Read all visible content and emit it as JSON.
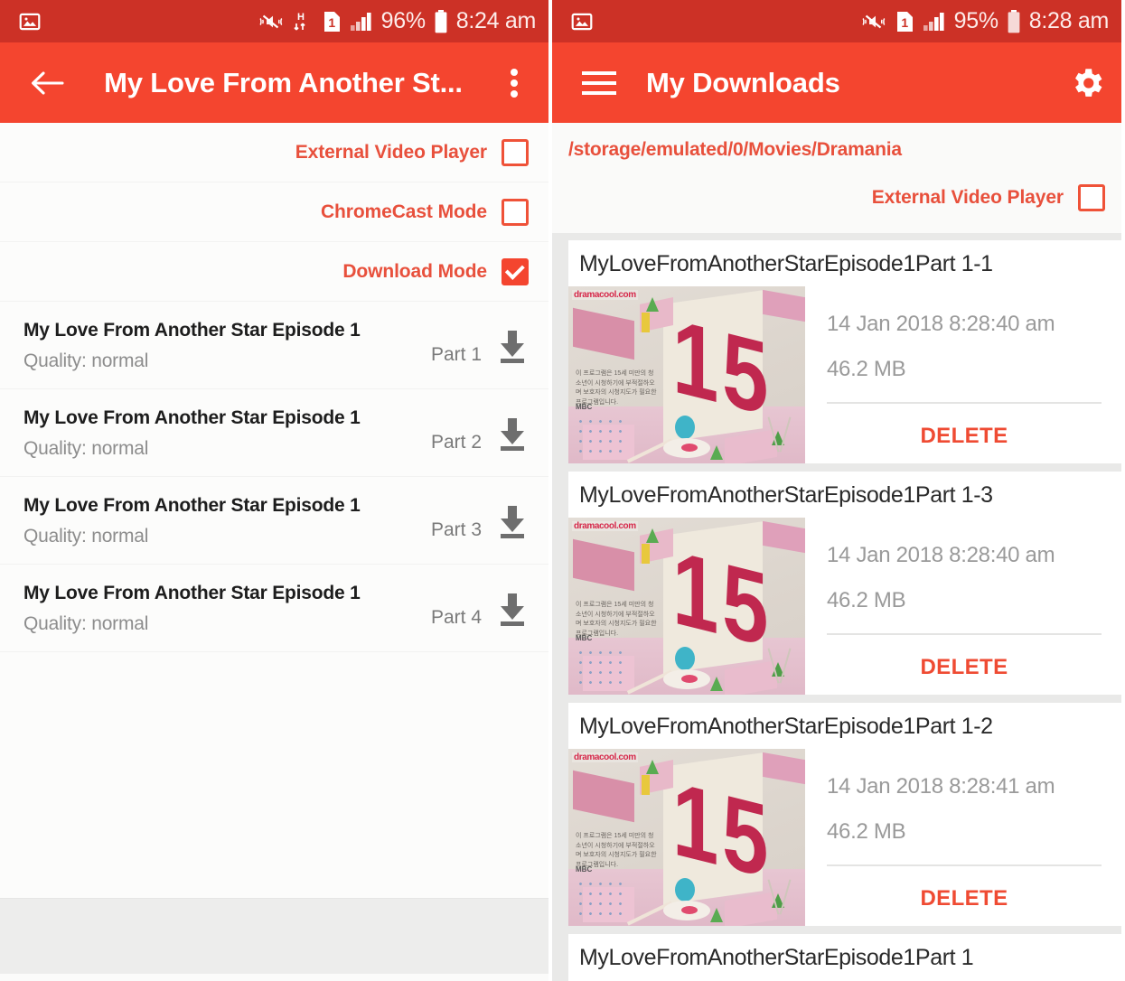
{
  "left": {
    "statusbar": {
      "icons": [
        "photo-icon",
        "mute-vibrate-icon",
        "hspa-data-icon",
        "sim1-icon",
        "signal-bars-icon"
      ],
      "hspa_label": "H",
      "sim_label": "1",
      "battery_percent": "96%",
      "time": "8:24 am"
    },
    "appbar": {
      "back_icon": "back-arrow-icon",
      "title": "My Love From Another St...",
      "overflow_icon": "overflow-menu-icon"
    },
    "options": [
      {
        "label": "External Video Player",
        "checked": false
      },
      {
        "label": "ChromeCast Mode",
        "checked": false
      },
      {
        "label": "Download Mode",
        "checked": true
      }
    ],
    "episodes": [
      {
        "title": "My Love From Another Star Episode 1",
        "quality": "Quality: normal",
        "part": "Part 1",
        "action_icon": "download-icon"
      },
      {
        "title": "My Love From Another Star Episode 1",
        "quality": "Quality: normal",
        "part": "Part 2",
        "action_icon": "download-icon"
      },
      {
        "title": "My Love From Another Star Episode 1",
        "quality": "Quality: normal",
        "part": "Part 3",
        "action_icon": "download-icon"
      },
      {
        "title": "My Love From Another Star Episode 1",
        "quality": "Quality: normal",
        "part": "Part 4",
        "action_icon": "download-icon"
      }
    ]
  },
  "right": {
    "statusbar": {
      "icons": [
        "photo-icon",
        "mute-vibrate-icon",
        "sim1-icon",
        "signal-bars-icon"
      ],
      "sim_label": "1",
      "battery_percent": "95%",
      "time": "8:28 am"
    },
    "appbar": {
      "menu_icon": "hamburger-menu-icon",
      "title": "My Downloads",
      "settings_icon": "gear-icon"
    },
    "storage_path": "/storage/emulated/0/Movies/Dramania",
    "option": {
      "label": "External Video Player",
      "checked": false
    },
    "delete_label": "DELETE",
    "thumbnail": {
      "watermark": "dramacool.com",
      "big_number": "15",
      "korean_note": "이 프로그램은 15세 미만의 청소년이 시청하기에 부적절하오며 보호자의 시청지도가 필요한 프로그램입니다.",
      "broadcaster": "MBC"
    },
    "downloads": [
      {
        "title": "MyLoveFromAnotherStarEpisode1Part 1-1",
        "date": "14 Jan 2018 8:28:40 am",
        "size": "46.2 MB"
      },
      {
        "title": "MyLoveFromAnotherStarEpisode1Part 1-3",
        "date": "14 Jan 2018 8:28:40 am",
        "size": "46.2 MB"
      },
      {
        "title": "MyLoveFromAnotherStarEpisode1Part 1-2",
        "date": "14 Jan 2018 8:28:41 am",
        "size": "46.2 MB"
      },
      {
        "title": "MyLoveFromAnotherStarEpisode1Part 1"
      }
    ]
  },
  "colors": {
    "statusbar_red": "#cc3126",
    "appbar_red": "#f4452f",
    "accent_red": "#e8503c",
    "delete_red": "#ef4b33",
    "card_bg": "#ffffff",
    "page_bg": "#e9e9e8"
  }
}
